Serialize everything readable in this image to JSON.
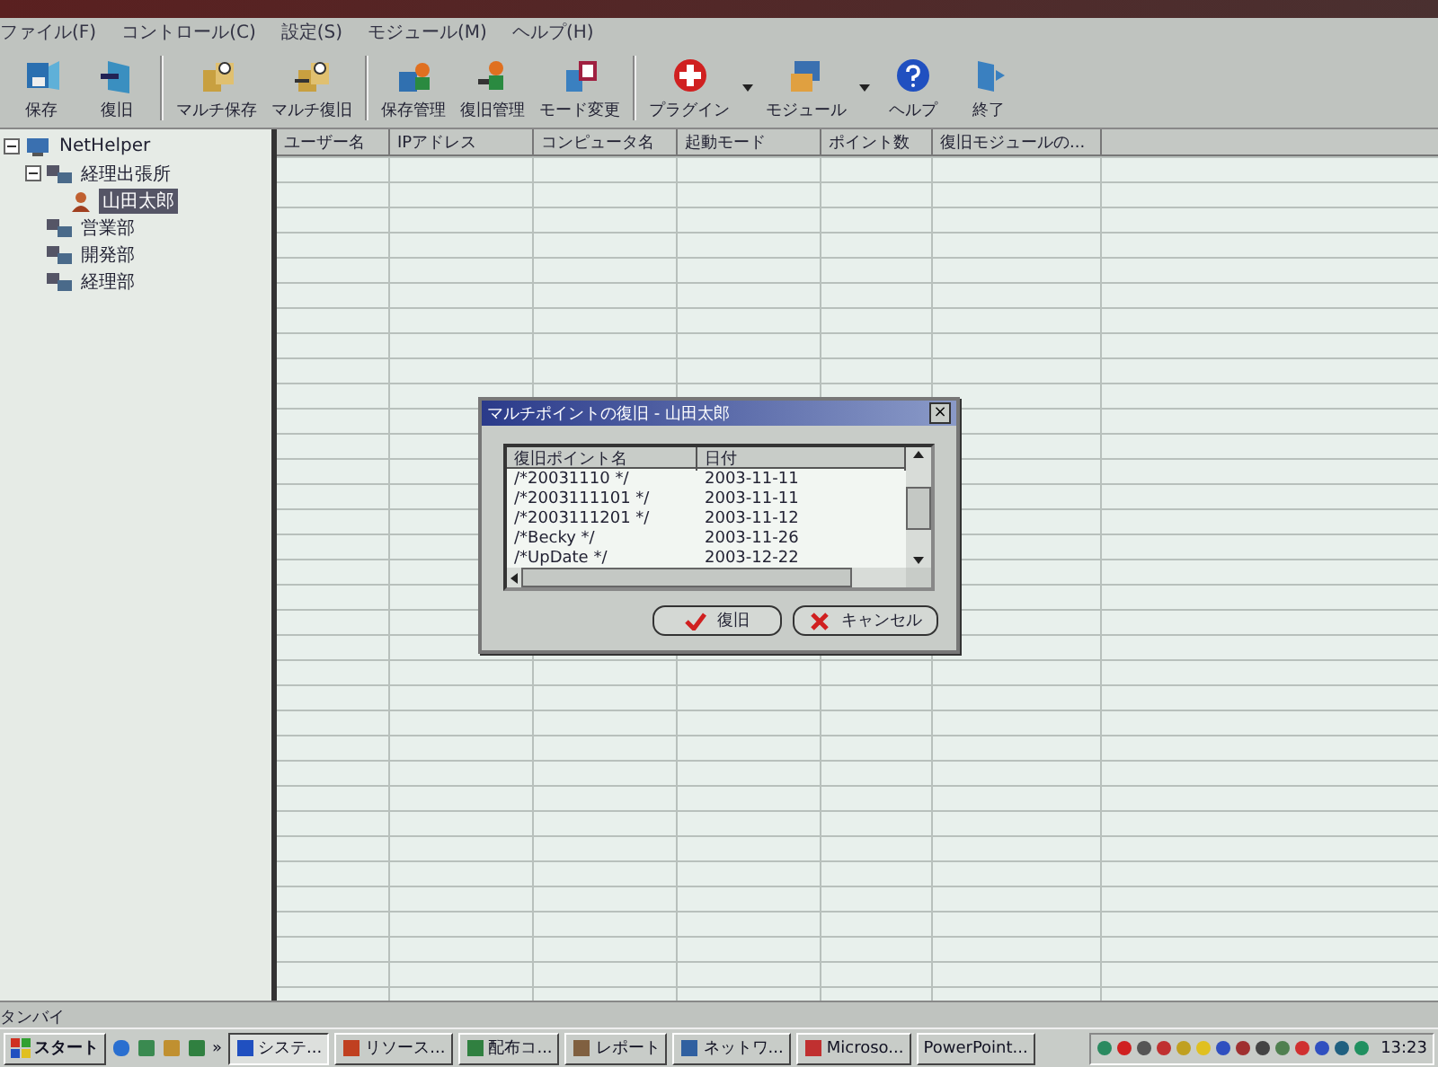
{
  "menu": [
    "ファイル(F)",
    "コントロール(C)",
    "設定(S)",
    "モジュール(M)",
    "ヘルプ(H)"
  ],
  "toolbar": [
    {
      "label": "保存",
      "dropdown": false
    },
    {
      "label": "復旧",
      "dropdown": false
    },
    {
      "label": "マルチ保存",
      "dropdown": false
    },
    {
      "label": "マルチ復旧",
      "dropdown": false
    },
    {
      "label": "保存管理",
      "dropdown": false
    },
    {
      "label": "復旧管理",
      "dropdown": false
    },
    {
      "label": "モード変更",
      "dropdown": false
    },
    {
      "label": "プラグイン",
      "dropdown": true
    },
    {
      "label": "モジュール",
      "dropdown": true
    },
    {
      "label": "ヘルプ",
      "dropdown": false
    },
    {
      "label": "終了",
      "dropdown": false
    }
  ],
  "tree": [
    {
      "label": "NetHelper",
      "kind": "root",
      "selected": false,
      "expanded": true,
      "children": [
        {
          "label": "経理出張所",
          "kind": "group",
          "selected": false,
          "expanded": true,
          "children": [
            {
              "label": "山田太郎",
              "kind": "user",
              "selected": true
            }
          ]
        },
        {
          "label": "営業部",
          "kind": "group",
          "selected": false
        },
        {
          "label": "開発部",
          "kind": "group",
          "selected": false
        },
        {
          "label": "経理部",
          "kind": "group",
          "selected": false
        }
      ]
    }
  ],
  "table": {
    "columns": [
      "ユーザー名",
      "IPアドレス",
      "コンピュータ名",
      "起動モード",
      "ポイント数",
      "復旧モジュールの..."
    ]
  },
  "dialog": {
    "title": "マルチポイントの復旧 - 山田太郎",
    "close": "×",
    "columns": [
      "復旧ポイント名",
      "日付"
    ],
    "rows": [
      [
        "/*20031110 */",
        "2003-11-11"
      ],
      [
        "/*2003111101 */",
        "2003-11-11"
      ],
      [
        "/*2003111201 */",
        "2003-11-12"
      ],
      [
        "/*Becky */",
        "2003-11-26"
      ],
      [
        "/*UpDate */",
        "2003-12-22"
      ]
    ],
    "buttons": [
      {
        "label": "復旧",
        "kind": "ok"
      },
      {
        "label": "キャンセル",
        "kind": "cancel"
      }
    ]
  },
  "status_bar": "タンバイ",
  "taskbar": {
    "start": "スタート",
    "more": "»",
    "tasks": [
      {
        "label": "システ...",
        "selected": true
      },
      {
        "label": "リソース...",
        "selected": false
      },
      {
        "label": "配布コ...",
        "selected": false
      },
      {
        "label": "レポート",
        "selected": false
      },
      {
        "label": "ネットワ...",
        "selected": false
      },
      {
        "label": "Microso...",
        "selected": false
      },
      {
        "label": "PowerPoint...",
        "selected": false
      }
    ],
    "clock": "13:23"
  }
}
